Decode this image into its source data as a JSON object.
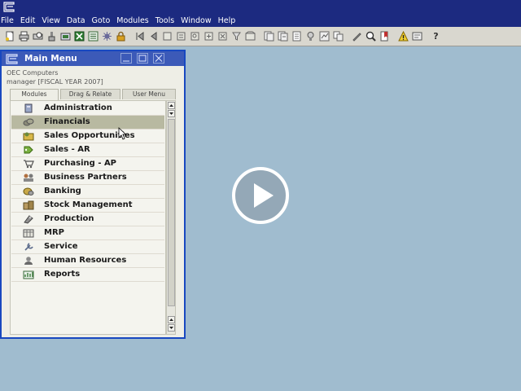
{
  "menubar": {
    "items": [
      "File",
      "Edit",
      "View",
      "Data",
      "Goto",
      "Modules",
      "Tools",
      "Window",
      "Help"
    ]
  },
  "toolbar": {
    "icons": [
      "new-icon",
      "print-icon",
      "preview-icon",
      "fax-icon",
      "email-icon",
      "excel-icon",
      "word-icon",
      "settings-icon",
      "lock-icon",
      "first-record-icon",
      "prev-record-icon",
      "next-record-icon",
      "last-record-icon",
      "find-icon",
      "add-icon",
      "delete-icon",
      "filter-icon",
      "sort-icon",
      "base-doc-icon",
      "target-doc-icon",
      "journal-icon",
      "drill-icon",
      "gross-profit-icon",
      "copy-icon",
      "pen-icon",
      "audit-icon",
      "bookmark-icon",
      "alert-icon",
      "message-icon",
      "help-icon"
    ],
    "help_label": "?"
  },
  "main_menu": {
    "title": "Main Menu",
    "company": "OEC Computers",
    "user_line": "manager  [FISCAL YEAR 2007]",
    "tabs": [
      {
        "label": "Modules",
        "active": true
      },
      {
        "label": "Drag & Relate",
        "active": false
      },
      {
        "label": "User Menu",
        "active": false
      }
    ],
    "modules": [
      {
        "label": "Administration",
        "icon": "administration-icon"
      },
      {
        "label": "Financials",
        "icon": "financials-icon",
        "selected": true
      },
      {
        "label": "Sales Opportunities",
        "icon": "sales-opportunities-icon"
      },
      {
        "label": "Sales - AR",
        "icon": "sales-ar-icon"
      },
      {
        "label": "Purchasing - AP",
        "icon": "purchasing-ap-icon"
      },
      {
        "label": "Business Partners",
        "icon": "business-partners-icon"
      },
      {
        "label": "Banking",
        "icon": "banking-icon"
      },
      {
        "label": "Stock Management",
        "icon": "stock-management-icon"
      },
      {
        "label": "Production",
        "icon": "production-icon"
      },
      {
        "label": "MRP",
        "icon": "mrp-icon"
      },
      {
        "label": "Service",
        "icon": "service-icon"
      },
      {
        "label": "Human Resources",
        "icon": "human-resources-icon"
      },
      {
        "label": "Reports",
        "icon": "reports-icon"
      }
    ]
  },
  "colors": {
    "titlebar": "#1c2a80",
    "desktop": "#a0bccf",
    "window_border": "#1848c0",
    "selected_row": "#b8b9a1"
  }
}
